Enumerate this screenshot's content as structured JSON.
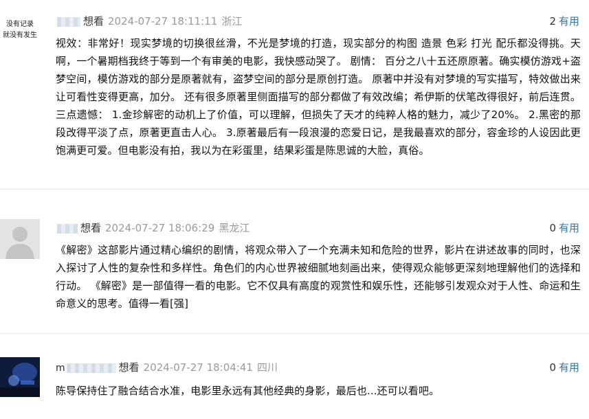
{
  "comments": [
    {
      "avatar_lines": [
        "没有记录",
        "就没有发生"
      ],
      "user_prefix": "",
      "verb": "想看",
      "time": "2024-07-27 18:11:11",
      "location": "浙江",
      "useful_count": "2",
      "useful_label": "有用",
      "body": "视效：非常好！现实梦境的切换很丝滑，不光是梦境的打造，现实部分的构图 造景 色彩 打光 配乐都没得挑。天啊，一个暑期档我终于等到一个有审美的电影，我快感动哭了。 剧情： 百分之八十五还原原著。确实模仿游戏+盗梦空间，模仿游戏的部分是原著就有，盗梦空间的部分是原创打造。 原著中并没有对梦境的写实描写，特效做出来让可看性变得更高，加分。 还有很多原著里侧面描写的部分都做了有效改编；希伊斯的伏笔改得很好，前后连贯。 三点遗憾： 1.金珍解密的动机上了价值，可以理解，但损失了天才的纯粹人格的魅力，减少了20%。 2.黑密的那段改得平淡了点，原著更直击人心。 3.原著最后有一段浪漫的恋爱日记，是我最喜欢的部分，容金珍的人设因此更饱满更可爱。但电影没有拍，我以为在彩蛋里，结果彩蛋是陈思诚的大脸，真俗。"
    },
    {
      "user_prefix": "",
      "verb": "想看",
      "time": "2024-07-27 18:06:29",
      "location": "黑龙江",
      "useful_count": "0",
      "useful_label": "有用",
      "body": "《解密》这部影片通过精心编织的剧情，将观众带入了一个充满未知和危险的世界，影片在讲述故事的同时，也深入探讨了人性的复杂性和多样性。角色们的内心世界被细腻地刻画出来，使得观众能够更深刻地理解他们的选择和行动。 《解密》是一部值得一看的电影。它不仅具有高度的观赏性和娱乐性，还能够引发观众对于人性、命运和生命意义的思考。值得一看[强]"
    },
    {
      "user_prefix": "m",
      "verb": "想看",
      "time": "2024-07-27 18:04:41",
      "location": "四川",
      "useful_count": "0",
      "useful_label": "有用",
      "body": "陈导保持住了融合结合水准，电影里永远有其他经典的身影，最后也...还可以看吧。"
    }
  ]
}
